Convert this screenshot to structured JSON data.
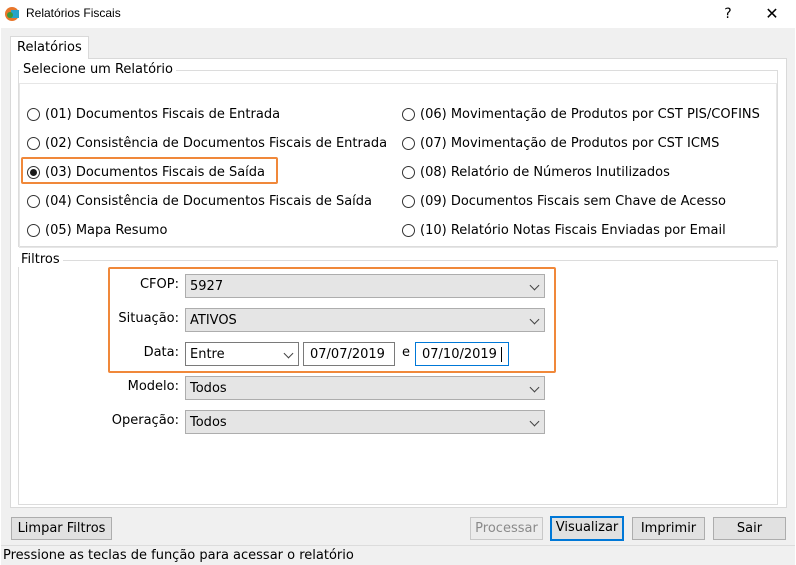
{
  "window": {
    "title": "Relatórios Fiscais",
    "help": "?",
    "close": "✕"
  },
  "tabs": [
    {
      "label": "Relatórios"
    }
  ],
  "reports_group": {
    "legend": "Selecione um Relatório",
    "left": [
      {
        "label": "(01) Documentos Fiscais de Entrada",
        "selected": false
      },
      {
        "label": "(02) Consistência de Documentos Fiscais de Entrada",
        "selected": false
      },
      {
        "label": "(03) Documentos Fiscais de Saída",
        "selected": true
      },
      {
        "label": "(04) Consistência de Documentos Fiscais de Saída",
        "selected": false
      },
      {
        "label": "(05) Mapa Resumo",
        "selected": false
      }
    ],
    "right": [
      {
        "label": "(06) Movimentação de Produtos por CST PIS/COFINS",
        "selected": false
      },
      {
        "label": "(07) Movimentação de Produtos por CST ICMS",
        "selected": false
      },
      {
        "label": "(08) Relatório de Números Inutilizados",
        "selected": false
      },
      {
        "label": "(09) Documentos Fiscais sem Chave de Acesso",
        "selected": false
      },
      {
        "label": "(10) Relatório Notas Fiscais Enviadas por Email",
        "selected": false
      }
    ]
  },
  "filters": {
    "legend": "Filtros",
    "cfop": {
      "label": "CFOP:",
      "value": "5927"
    },
    "situacao": {
      "label": "Situação:",
      "value": "ATIVOS"
    },
    "data": {
      "label": "Data:",
      "mode": "Entre",
      "from": "07/07/2019",
      "sep": "e",
      "to": "07/10/2019"
    },
    "modelo": {
      "label": "Modelo:",
      "value": "Todos"
    },
    "operacao": {
      "label": "Operação:",
      "value": "Todos"
    }
  },
  "buttons": {
    "limpar": "Limpar Filtros",
    "processar": "Processar",
    "visualizar": "Visualizar",
    "imprimir": "Imprimir",
    "sair": "Sair"
  },
  "status": "Pressione as teclas de função para acessar o relatório",
  "colors": {
    "highlight": "#f0883a",
    "focus": "#0078d7"
  }
}
